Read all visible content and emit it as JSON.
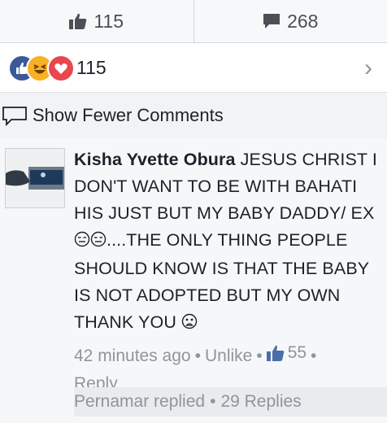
{
  "stats": {
    "likes": "115",
    "comments": "268"
  },
  "reactions": {
    "count": "115",
    "icons": [
      "like-icon",
      "haha-icon",
      "love-icon"
    ],
    "colors": {
      "like": "#3b5998",
      "haha": "#f7b125",
      "love": "#e9474e"
    }
  },
  "show_fewer": {
    "label": "Show Fewer Comments"
  },
  "comment": {
    "author": "Kisha Yvette Obura",
    "text_part1": "JESUS CHRIST I DON'T WANT TO BE WITH BAHATI HIS JUST BUT MY BABY DADDY/ EX",
    "text_part2": "....THE ONLY THING PEOPLE SHOULD KNOW IS THAT THE BABY IS NOT ADOPTED BUT MY OWN THANK YOU",
    "time": "42 minutes ago",
    "unlike_label": "Unlike",
    "like_count": "55",
    "reply_label": "Reply",
    "replies_by": "Pernamar replied",
    "replies_count": "29 Replies"
  }
}
